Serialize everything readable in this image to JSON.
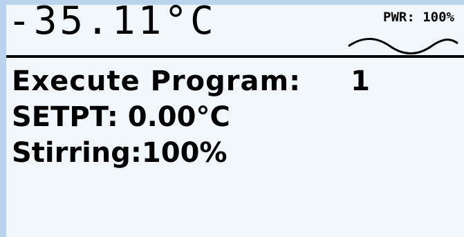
{
  "display": {
    "temperature": "-35.11°C",
    "power": "PWR: 100%",
    "power_icon": "sine-wave-icon",
    "program_label": "Execute Program:",
    "program_number": "1",
    "setpoint": "SETPT: 0.00°C",
    "stirring": "Stirring:100%"
  },
  "colors": {
    "bezel": "#b9d3ec",
    "screen": "#f1f7fb",
    "text": "#000000"
  }
}
